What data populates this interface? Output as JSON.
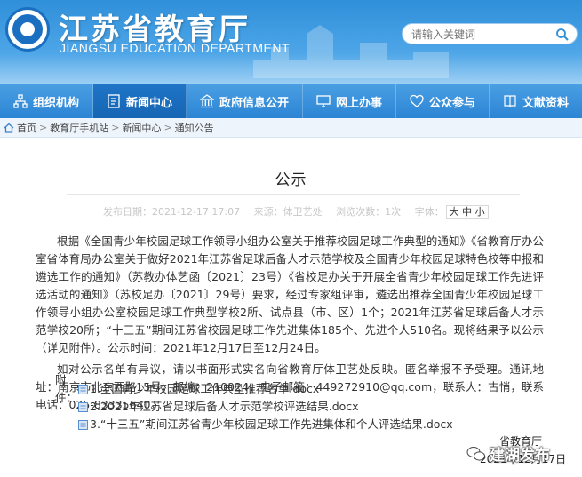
{
  "header": {
    "title": "江苏省教育厅",
    "subtitle": "JIANGSU EDUCATION DEPARTMENT",
    "search_placeholder": "请输入关键词"
  },
  "nav": {
    "items": [
      {
        "label": "组织机构",
        "icon": "org-icon"
      },
      {
        "label": "新闻中心",
        "icon": "news-icon"
      },
      {
        "label": "政府信息公开",
        "icon": "gov-info-icon"
      },
      {
        "label": "网上办事",
        "icon": "online-service-icon"
      },
      {
        "label": "公众参与",
        "icon": "public-participation-icon"
      },
      {
        "label": "文献资料",
        "icon": "documents-icon"
      }
    ]
  },
  "breadcrumb": {
    "items": [
      "首页",
      "教育厅手机站",
      "新闻中心",
      "通知公告"
    ],
    "separator": ">"
  },
  "article": {
    "title": "公示",
    "meta": {
      "date": "发布日期：2021-12-17 17:07",
      "source": "来源：体卫艺处",
      "views": "浏览次数：1次",
      "font_size_label": "字体：",
      "font_size_switch": "大 中 小"
    },
    "paragraph_1": "根据《全国青少年校园足球工作领导小组办公室关于推荐校园足球工作典型的通知》《省教育厅办公室省体育局办公室关于做好2021年江苏省足球后备人才示范学校及全国青少年校园足球特色校等申报和遴选工作的通知》（苏教办体艺函〔2021〕23号）《省校足办关于开展全省青少年校园足球工作先进评选活动的通知》（苏校足办〔2021〕29号）要求，经过专家组评审，遴选出推荐全国青少年校园足球工作领导小组办公室校园足球工作典型学校2所、试点县（市、区）1个；2021年江苏省足球后备人才示范学校20所；“十三五”期间江苏省校园足球工作先进集体185个、先进个人510名。现将结果予以公示（详见附件）。公示时间：2021年12月17日至12月24日。",
    "paragraph_2": "如对公示名单有异议，请以书面形式实名向省教育厅体卫艺处反映。匿名举报不予受理。通讯地址：南京市北京西路15号，邮编：210024，电子邮箱：449272910@qq.com，联系人：古悄，联系电话：025-83335640。",
    "attachments_label": "附件：",
    "attachments": [
      "1.全国青少年校园足球工作典型推荐名单.docx",
      "2.2021年江苏省足球后备人才示范学校评选结果.docx",
      "3.“十三五”期间江苏省青少年校园足球工作先进集体和个人评选结果.docx"
    ],
    "signature": "省教育厅",
    "signature_date": "2021年12月17日"
  },
  "watermark": {
    "text": "建湖发布"
  },
  "colors": {
    "header_blue": "#2f8fd9",
    "nav_active": "#1666b4",
    "breadcrumb_bg": "#eef4fb"
  }
}
